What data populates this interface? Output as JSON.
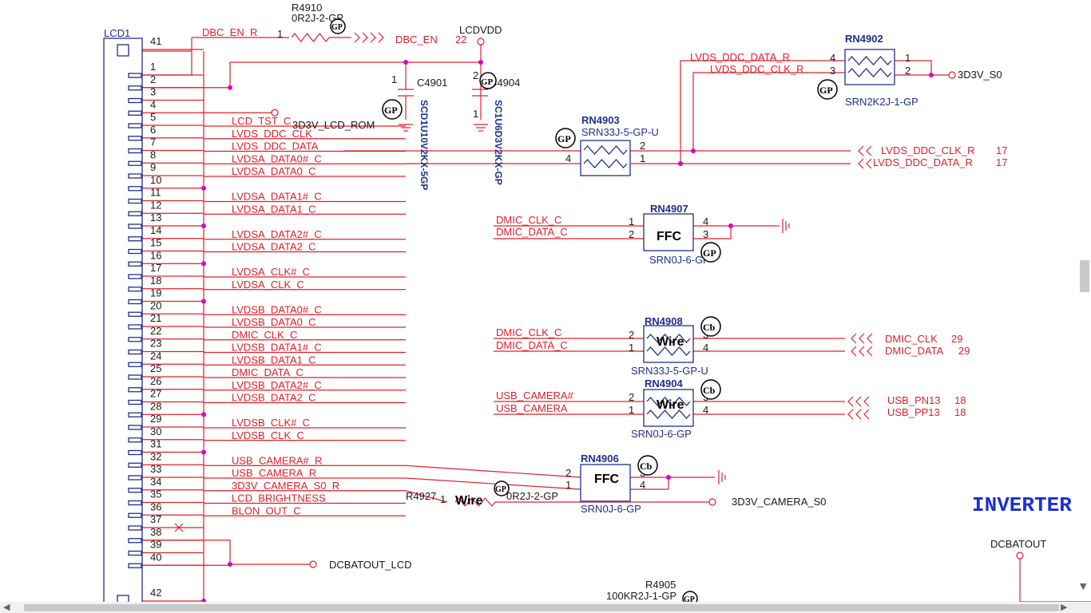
{
  "connector": {
    "ref": "LCD1",
    "pins": [
      "41",
      "1",
      "2",
      "3",
      "4",
      "5",
      "6",
      "7",
      "8",
      "9",
      "10",
      "11",
      "12",
      "13",
      "14",
      "15",
      "16",
      "17",
      "18",
      "19",
      "20",
      "21",
      "22",
      "23",
      "24",
      "25",
      "26",
      "27",
      "28",
      "29",
      "30",
      "31",
      "32",
      "33",
      "34",
      "35",
      "36",
      "37",
      "38",
      "39",
      "40",
      "42"
    ],
    "nets": [
      "LCD_TST_C",
      "LVDS_DDC_CLK",
      "LVDS_DDC_DATA",
      "LVDSA_DATA0#_C",
      "LVDSA_DATA0_C",
      "LVDSA_DATA1#_C",
      "LVDSA_DATA1_C",
      "LVDSA_DATA2#_C",
      "LVDSA_DATA2_C",
      "LVDSA_CLK#_C",
      "LVDSA_CLK_C",
      "LVDSB_DATA0#_C",
      "LVDSB_DATA0_C",
      "DMIC_CLK_C",
      "LVDSB_DATA1#_C",
      "LVDSB_DATA1_C",
      "DMIC_DATA_C",
      "LVDSB_DATA2#_C",
      "LVDSB_DATA2_C",
      "LVDSB_CLK#_C",
      "LVDSB_CLK_C",
      "USB_CAMERA#_R",
      "USB_CAMERA_R",
      "3D3V_CAMERA_S0_R",
      "LCD_BRIGHTNESS",
      "BLON_OUT_C"
    ],
    "dbc_en_r": "DBC_EN_R",
    "rom_port": "3D3V_LCD_ROM",
    "dcbatout_lcd": "DCBATOUT_LCD"
  },
  "r4910": {
    "ref": "R4910",
    "value": "0R2J-2-GP",
    "pin1": "1",
    "net": "DBC_EN",
    "page": "22"
  },
  "lcdvdd": "LCDVDD",
  "caps": {
    "c4901": {
      "ref": "C4901",
      "part": "SCD1U10V2KX-5GP",
      "pin": "1"
    },
    "c4904": {
      "ref": "C4904",
      "part": "SC1U6D3V2KX-GP",
      "pin2": "2",
      "pin1": "1"
    }
  },
  "rn4902": {
    "ref": "RN4902",
    "part": "SRN2K2J-1-GP",
    "pins": [
      "4",
      "3",
      "1",
      "2"
    ],
    "net_data": "LVDS_DDC_DATA_R",
    "net_clk": "LVDS_DDC_CLK_R",
    "power": "3D3V_S0"
  },
  "rn4903": {
    "ref": "RN4903",
    "part": "SRN33J-5-GP-U",
    "pins": [
      "3",
      "4",
      "2",
      "1"
    ],
    "out_clk": "LVDS_DDC_CLK_R",
    "out_data": "LVDS_DDC_DATA_R",
    "page": "17"
  },
  "rn4907": {
    "ref": "RN4907",
    "part": "SRN0J-6-GP",
    "label": "FFC",
    "pins": [
      "1",
      "2",
      "4",
      "3"
    ],
    "in1": "DMIC_CLK_C",
    "in2": "DMIC_DATA_C"
  },
  "rn4908": {
    "ref": "RN4908",
    "part": "SRN33J-5-GP-U",
    "label": "Wire",
    "pins": [
      "2",
      "1",
      "3",
      "4"
    ],
    "in1": "DMIC_CLK_C",
    "in2": "DMIC_DATA_C",
    "out1": "DMIC_CLK",
    "out2": "DMIC_DATA",
    "page": "29"
  },
  "rn4904": {
    "ref": "RN4904",
    "part": "SRN0J-6-GP",
    "label": "Wire",
    "pins": [
      "2",
      "1",
      "3",
      "4"
    ],
    "in1": "USB_CAMERA#",
    "in2": "USB_CAMERA",
    "out1": "USB_PN13",
    "out2": "USB_PP13",
    "page": "18"
  },
  "rn4906": {
    "ref": "RN4906",
    "part": "SRN0J-6-GP",
    "label": "FFC",
    "pins": [
      "2",
      "1",
      "3",
      "4"
    ]
  },
  "r4927": {
    "ref": "R4927",
    "value": "0R2J-2-GP",
    "label": "Wire",
    "pin1": "1",
    "power": "3D3V_CAMERA_S0"
  },
  "r4905": {
    "ref": "R4905",
    "value": "100KR2J-1-GP",
    "pin": "1"
  },
  "inverter": "INVERTER",
  "dcbatout": "DCBATOUT",
  "stamps": {
    "gp": "GP",
    "cb": "Cb"
  },
  "colors": {
    "wire": "#e0202a",
    "part": "#1f2f8f",
    "text": "#1a1a1a",
    "title": "#1f2fd0"
  }
}
